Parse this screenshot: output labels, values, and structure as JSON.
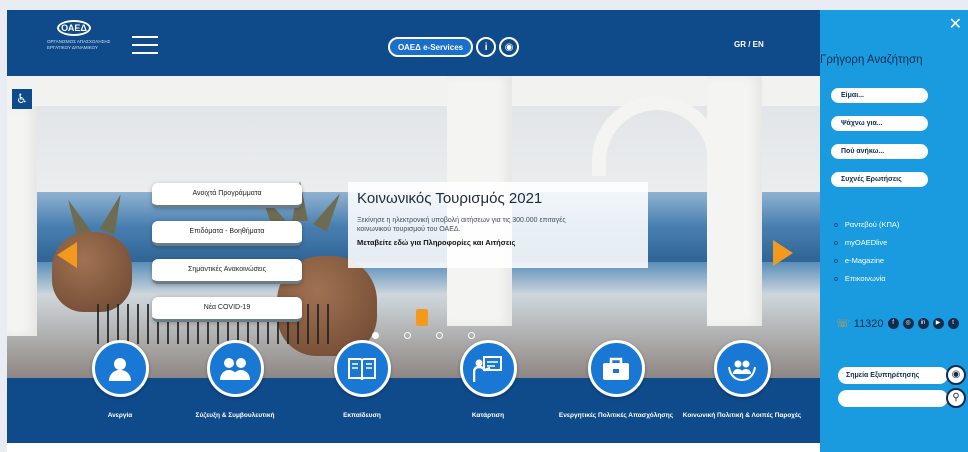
{
  "header": {
    "logo_text": "ΟΑΕΔ",
    "logo_subtitle": "ΟΡΓΑΝΙΣΜΟΣ ΑΠΑΣΧΟΛΗΣΗΣ ΕΡΓΑΤΙΚΟΥ ΔΥΝΑΜΙΚΟΥ",
    "eservices_label": "ΟΑΕΔ e-Services",
    "info_icon_text": "i",
    "languages": "GR / EN"
  },
  "hero": {
    "quick_links": [
      "Ανοιχτά Προγράμματα",
      "Επιδόματα - Βοηθήματα",
      "Σημαντικές Ανακοινώσεις",
      "Νέα COVID-19"
    ],
    "promo": {
      "title": "Κοινωνικός Τουρισμός 2021",
      "description": "Ξεκίνησε η ηλεκτρονική υποβολή αιτήσεων για τις 300.000 επιταγές κοινωνικού τουρισμού του ΟΑΕΔ.",
      "link": "Μεταβείτε εδώ για Πληροφορίες και Αιτήσεις"
    },
    "slider_dots": 4,
    "active_dot": 0
  },
  "services": [
    {
      "label": "Ανεργία",
      "icon": "person-icon"
    },
    {
      "label": "Σύζευξη & Συμβουλευτική",
      "icon": "people-icon"
    },
    {
      "label": "Εκπαίδευση",
      "icon": "book-icon"
    },
    {
      "label": "Κατάρτιση",
      "icon": "presentation-icon"
    },
    {
      "label": "Ενεργητικές Πολιτικές Απασχόλησης",
      "icon": "briefcase-icon"
    },
    {
      "label": "Κοινωνική Πολιτική & Λοιπές Παροχές",
      "icon": "hands-icon"
    }
  ],
  "quick_search": {
    "title": "Γρήγορη Αναζήτηση",
    "buttons": [
      "Είμαι...",
      "Ψάχνω για...",
      "Πού ανήκω...",
      "Συχνές Ερωτήσεις"
    ],
    "links": [
      "Ραντεβού (ΚΠΑ)",
      "myOAEDlive",
      "e-Magazine",
      "Επικοινωνία"
    ],
    "phone": "11320",
    "social": [
      "f",
      "◎",
      "in",
      "▶",
      "t"
    ],
    "points_label": "Σημεία Εξυπηρέτησης",
    "search_placeholder": ""
  },
  "colors": {
    "header_blue": "#0f4a8a",
    "panel_blue": "#1a9be0",
    "accent_orange": "#f39a1d",
    "service_blue": "#1a78d5"
  }
}
